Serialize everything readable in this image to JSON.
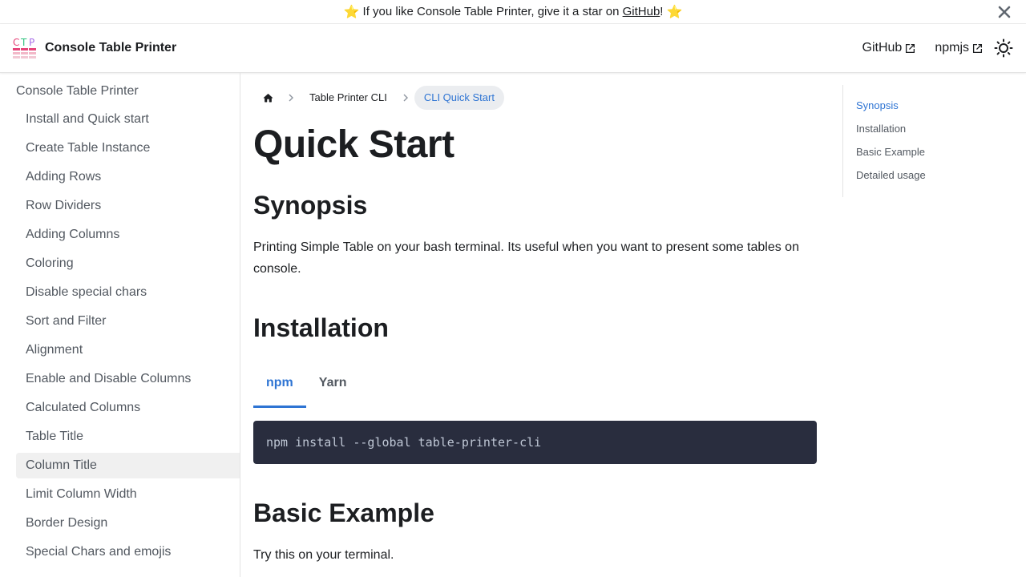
{
  "announcement": {
    "prefix": "If you like Console Table Printer, give it a star on",
    "link_text": "GitHub",
    "suffix": "!",
    "star": "⭐"
  },
  "navbar": {
    "title": "Console Table Printer",
    "links": [
      {
        "label": "GitHub"
      },
      {
        "label": "npmjs"
      }
    ]
  },
  "sidebar": {
    "root": "Console Table Printer",
    "items": [
      {
        "label": "Install and Quick start"
      },
      {
        "label": "Create Table Instance"
      },
      {
        "label": "Adding Rows"
      },
      {
        "label": "Row Dividers"
      },
      {
        "label": "Adding Columns"
      },
      {
        "label": "Coloring"
      },
      {
        "label": "Disable special chars"
      },
      {
        "label": "Sort and Filter"
      },
      {
        "label": "Alignment"
      },
      {
        "label": "Enable and Disable Columns"
      },
      {
        "label": "Calculated Columns"
      },
      {
        "label": "Table Title"
      },
      {
        "label": "Column Title"
      },
      {
        "label": "Limit Column Width"
      },
      {
        "label": "Border Design"
      },
      {
        "label": "Special Chars and emojis"
      }
    ],
    "active_index": 12
  },
  "breadcrumbs": {
    "items": [
      "Table Printer CLI",
      "CLI Quick Start"
    ]
  },
  "content": {
    "title": "Quick Start",
    "synopsis_heading": "Synopsis",
    "synopsis_text": "Printing Simple Table on your bash terminal. Its useful when you want to present some tables on console.",
    "installation_heading": "Installation",
    "tabs": [
      {
        "label": "npm"
      },
      {
        "label": "Yarn"
      }
    ],
    "code": "npm install --global table-printer-cli",
    "basic_heading": "Basic Example",
    "basic_text": "Try this on your terminal."
  },
  "toc": {
    "items": [
      "Synopsis",
      "Installation",
      "Basic Example",
      "Detailed usage"
    ]
  },
  "colors": {
    "primary": "#2e74d3",
    "code_bg": "#292d3e",
    "code_text": "#bfc7d5",
    "active_bg": "#f0f0f0"
  }
}
